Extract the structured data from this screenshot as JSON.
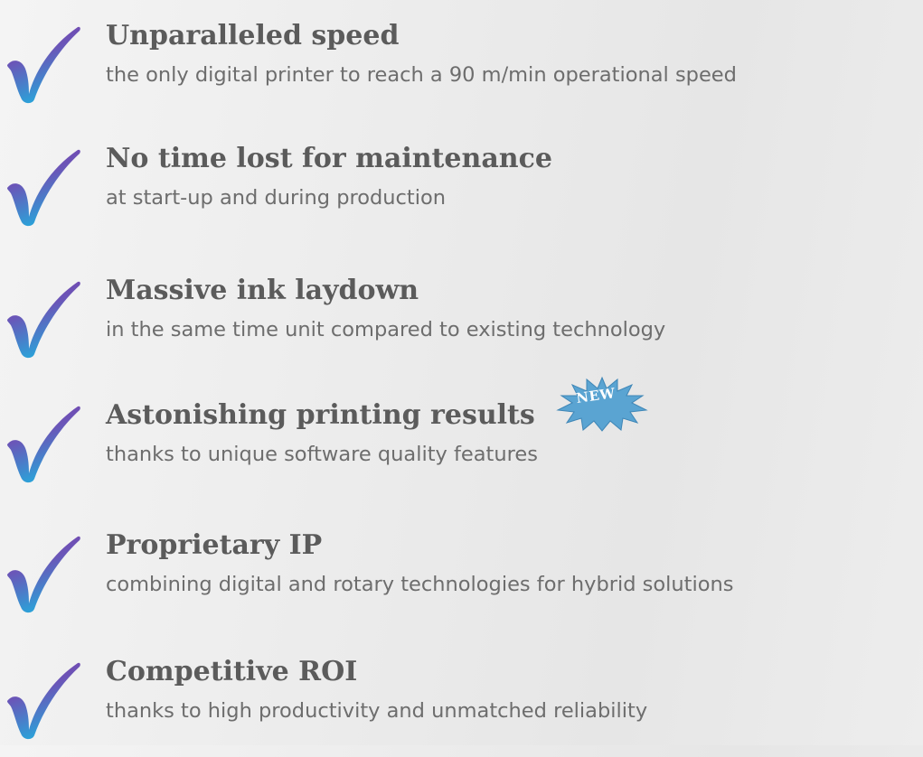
{
  "features": [
    {
      "title": "Unparalleled speed",
      "description": "the only digital printer to reach a 90 m/min operational speed",
      "icon": "checkmark-icon"
    },
    {
      "title": "No time lost for maintenance",
      "description": "at start-up and during production",
      "icon": "checkmark-icon"
    },
    {
      "title": "Massive ink laydown",
      "description": "in the same time unit compared to existing technology",
      "icon": "checkmark-icon"
    },
    {
      "title": "Astonishing printing results",
      "description": "thanks to unique software quality features",
      "icon": "checkmark-icon",
      "badge": "NEW"
    },
    {
      "title": "Proprietary IP",
      "description": "combining digital and rotary technologies for hybrid solutions",
      "icon": "checkmark-icon"
    },
    {
      "title": "Competitive ROI",
      "description": "thanks to high productivity and unmatched reliability",
      "icon": "checkmark-icon"
    }
  ],
  "colors": {
    "title": "#5b5b5b",
    "description": "#6d6d6d",
    "check_top": "#7a3fb0",
    "check_bottom": "#2f9fd8",
    "badge_fill": "#5aa4d2"
  }
}
